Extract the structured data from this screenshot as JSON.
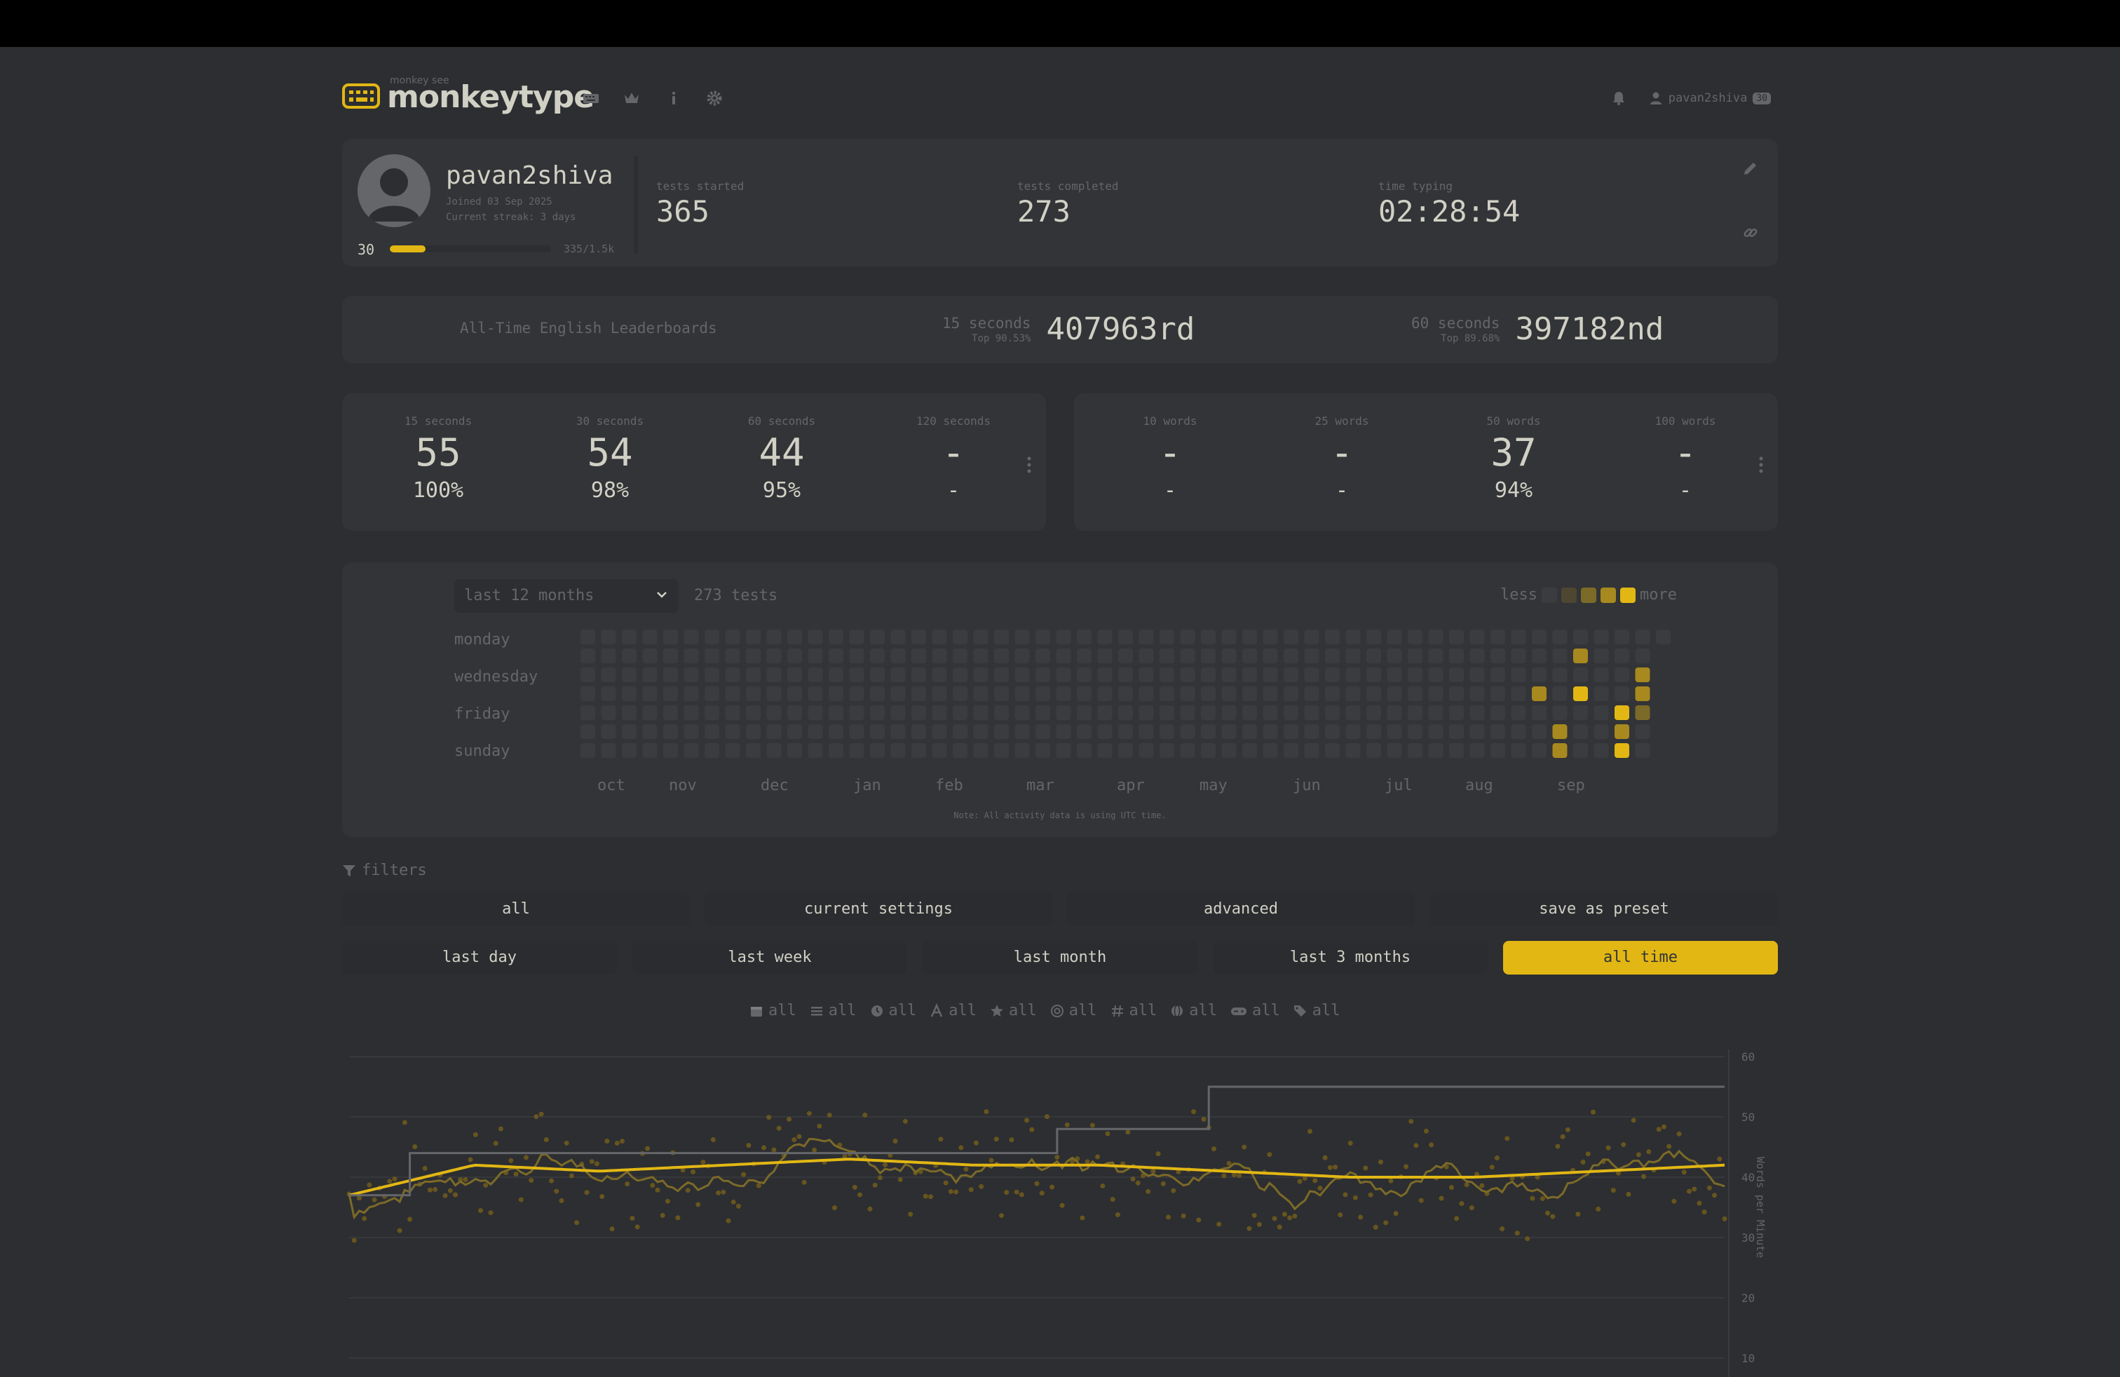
{
  "header": {
    "logo_small": "monkey see",
    "logo_text": "monkeytype",
    "nav_icons": [
      "keyboard-icon",
      "crown-icon",
      "info-icon",
      "gear-icon"
    ],
    "username": "pavan2shiva",
    "level_badge": "30"
  },
  "profile": {
    "username": "pavan2shiva",
    "joined": "Joined 03 Sep 2025",
    "streak": "Current streak: 3 days",
    "level": "30",
    "xp_text": "335/1.5k",
    "xp_fraction": 0.22,
    "stats": [
      {
        "label": "tests started",
        "value": "365"
      },
      {
        "label": "tests completed",
        "value": "273"
      },
      {
        "label": "time typing",
        "value": "02:28:54"
      }
    ]
  },
  "leaderboards": {
    "title": "All-Time English Leaderboards",
    "items": [
      {
        "mode": "15 seconds",
        "top": "Top 90.53%",
        "rank": "407963rd"
      },
      {
        "mode": "60 seconds",
        "top": "Top 89.68%",
        "rank": "397182nd"
      }
    ]
  },
  "pb_time": [
    {
      "label": "15 seconds",
      "wpm": "55",
      "acc": "100%"
    },
    {
      "label": "30 seconds",
      "wpm": "54",
      "acc": "98%"
    },
    {
      "label": "60 seconds",
      "wpm": "44",
      "acc": "95%"
    },
    {
      "label": "120 seconds",
      "wpm": "-",
      "acc": "-"
    }
  ],
  "pb_words": [
    {
      "label": "10 words",
      "wpm": "-",
      "acc": "-"
    },
    {
      "label": "25 words",
      "wpm": "-",
      "acc": "-"
    },
    {
      "label": "50 words",
      "wpm": "37",
      "acc": "94%"
    },
    {
      "label": "100 words",
      "wpm": "-",
      "acc": "-"
    }
  ],
  "activity": {
    "range": "last 12 months",
    "count": "273 tests",
    "legend_less": "less",
    "legend_more": "more",
    "colors": [
      "#3a3c3f",
      "#4e4631",
      "#7c6a28",
      "#a8891f",
      "#e2b714"
    ],
    "days": [
      "monday",
      "wednesday",
      "friday",
      "sunday"
    ],
    "months": [
      "oct",
      "nov",
      "dec",
      "jan",
      "feb",
      "mar",
      "apr",
      "may",
      "jun",
      "jul",
      "aug",
      "sep"
    ],
    "note": "Note: All activity data is using UTC time.",
    "active_cells": [
      {
        "week": 48,
        "day": 1,
        "level": 3
      },
      {
        "week": 46,
        "day": 3,
        "level": 3
      },
      {
        "week": 48,
        "day": 3,
        "level": 4
      },
      {
        "week": 47,
        "day": 5,
        "level": 3
      },
      {
        "week": 47,
        "day": 6,
        "level": 3
      },
      {
        "week": 51,
        "day": 2,
        "level": 3
      },
      {
        "week": 51,
        "day": 3,
        "level": 3
      },
      {
        "week": 51,
        "day": 4,
        "level": 2
      },
      {
        "week": 50,
        "day": 4,
        "level": 4
      },
      {
        "week": 50,
        "day": 5,
        "level": 3
      },
      {
        "week": 50,
        "day": 6,
        "level": 4
      },
      {
        "week": 50,
        "day": 7,
        "level": 4
      }
    ]
  },
  "filters": {
    "title": "filters",
    "row1": [
      "all",
      "current settings",
      "advanced",
      "save as preset"
    ],
    "row2": [
      "last day",
      "last week",
      "last month",
      "last 3 months",
      "all time"
    ],
    "active": "all time",
    "mini": [
      {
        "icon": "calendar-icon",
        "label": "all"
      },
      {
        "icon": "list-icon",
        "label": "all"
      },
      {
        "icon": "clock-icon",
        "label": "all"
      },
      {
        "icon": "font-icon",
        "label": "all"
      },
      {
        "icon": "star-icon",
        "label": "all"
      },
      {
        "icon": "at-icon",
        "label": "all"
      },
      {
        "icon": "hashtag-icon",
        "label": "all"
      },
      {
        "icon": "globe-icon",
        "label": "all"
      },
      {
        "icon": "gamepad-icon",
        "label": "all"
      },
      {
        "icon": "tags-icon",
        "label": "all"
      }
    ]
  },
  "chart_data": {
    "type": "line",
    "ylabel": "Words per Minute",
    "ylim": [
      10,
      60
    ],
    "yticks": [
      60,
      50,
      40,
      30,
      20,
      10
    ],
    "accent": "#e2b714",
    "series": [
      {
        "values_pb": [
          37,
          44,
          44,
          44,
          44,
          48,
          55,
          55,
          55,
          55,
          55
        ]
      },
      {
        "average_profile": [
          37,
          42,
          41,
          42,
          43,
          42,
          42,
          41,
          40,
          40,
          41,
          42
        ]
      }
    ]
  }
}
